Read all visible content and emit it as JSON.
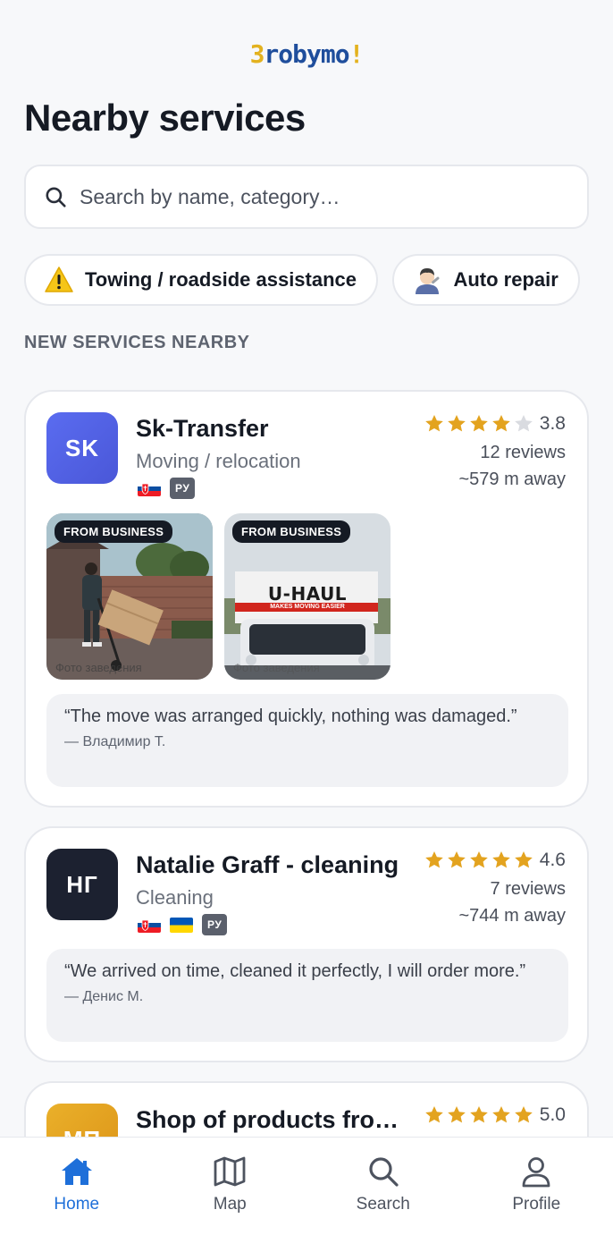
{
  "app": {
    "logo_part1": "З",
    "logo_part2": "robymo",
    "logo_part3": "!",
    "brand_blue": "#1f4e9c",
    "brand_yellow": "#e3b21f"
  },
  "header": {
    "title": "Nearby services"
  },
  "search": {
    "placeholder": "Search by name, category…"
  },
  "chips": [
    {
      "label": "Towing / roadside assistance",
      "icon": "warning-icon"
    },
    {
      "label": "Auto repair",
      "icon": "mechanic-icon"
    }
  ],
  "section": {
    "title": "NEW SERVICES NEARBY"
  },
  "services": [
    {
      "initials": "SK",
      "avatar_color": "#5566ea",
      "name": "Sk-Transfer",
      "category": "Moving / relocation",
      "flags": [
        "slovakia-flag-icon"
      ],
      "lang_badge": "РУ",
      "rating": "3.8",
      "rating_value": 3.8,
      "reviews": "12 reviews",
      "distance": "~579 m away",
      "photos": [
        {
          "badge": "FROM BUSINESS",
          "caption": "Фото заведения"
        },
        {
          "badge": "FROM BUSINESS",
          "caption": "Фото заведения",
          "truck_text": "U-HAUL",
          "truck_subtext": "MAKES MOVING EASIER"
        }
      ],
      "quote": "“The move was arranged quickly, nothing was damaged.”",
      "quote_author": "— Владимир Т."
    },
    {
      "initials": "НГ",
      "avatar_color": "#1c2130",
      "name": "Natalie Graff - cleaning",
      "category": "Cleaning",
      "flags": [
        "slovakia-flag-icon",
        "ukraine-flag-icon"
      ],
      "lang_badge": "РУ",
      "rating": "4.6",
      "rating_value": 4.6,
      "reviews": "7 reviews",
      "distance": "~744 m away",
      "quote": "“We arrived on time, cleaned it perfectly, I will order more.”",
      "quote_author": "— Денис М."
    },
    {
      "initials": "МП",
      "avatar_color": "#e2a11f",
      "name": "Shop of products fro…",
      "rating": "5.0",
      "rating_value": 5.0
    }
  ],
  "colors": {
    "star": "#e3a31f",
    "star_empty": "#d9dbe0",
    "accent": "#1e6fd9"
  },
  "nav": {
    "home": "Home",
    "map": "Map",
    "search": "Search",
    "profile": "Profile",
    "active": "home"
  }
}
